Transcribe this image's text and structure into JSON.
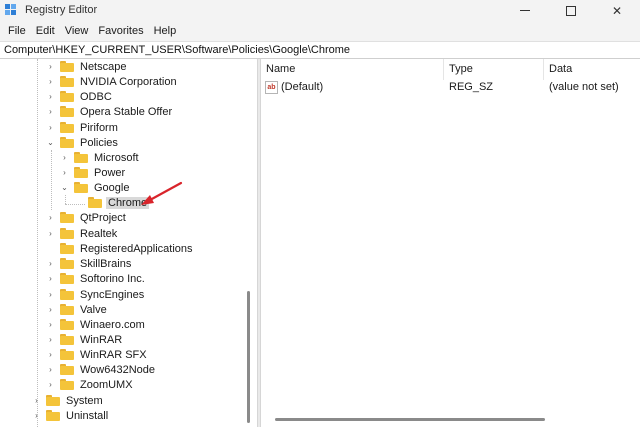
{
  "window": {
    "title": "Registry Editor",
    "controls": {
      "minimize": "",
      "maximize": "",
      "close": "✕"
    }
  },
  "menu": [
    "File",
    "Edit",
    "View",
    "Favorites",
    "Help"
  ],
  "address": "Computer\\HKEY_CURRENT_USER\\Software\\Policies\\Google\\Chrome",
  "tree": {
    "nodes": [
      {
        "label": "Netscape",
        "expander": "›"
      },
      {
        "label": "NVIDIA Corporation",
        "expander": "›"
      },
      {
        "label": "ODBC",
        "expander": "›"
      },
      {
        "label": "Opera Stable Offer",
        "expander": "›"
      },
      {
        "label": "Piriform",
        "expander": "›"
      },
      {
        "label": "Policies",
        "expander": "⌄"
      },
      {
        "label": "Microsoft",
        "expander": "›"
      },
      {
        "label": "Power",
        "expander": "›"
      },
      {
        "label": "Google",
        "expander": "⌄"
      },
      {
        "label": "Chrome",
        "expander": ""
      },
      {
        "label": "QtProject",
        "expander": "›"
      },
      {
        "label": "Realtek",
        "expander": "›"
      },
      {
        "label": "RegisteredApplications",
        "expander": ""
      },
      {
        "label": "SkillBrains",
        "expander": "›"
      },
      {
        "label": "Softorino Inc.",
        "expander": "›"
      },
      {
        "label": "SyncEngines",
        "expander": "›"
      },
      {
        "label": "Valve",
        "expander": "›"
      },
      {
        "label": "Winaero.com",
        "expander": "›"
      },
      {
        "label": "WinRAR",
        "expander": "›"
      },
      {
        "label": "WinRAR SFX",
        "expander": "›"
      },
      {
        "label": "Wow6432Node",
        "expander": "›"
      },
      {
        "label": "ZoomUMX",
        "expander": "›"
      },
      {
        "label": "System",
        "expander": "›"
      },
      {
        "label": "Uninstall",
        "expander": "›"
      }
    ]
  },
  "values": {
    "columns": {
      "name": "Name",
      "type": "Type",
      "data": "Data"
    },
    "rows": [
      {
        "icon": "ab",
        "name": "(Default)",
        "type": "REG_SZ",
        "data": "(value not set)"
      }
    ]
  },
  "colors": {
    "folder": "#f4c43a",
    "selection": "#d9d9d9",
    "annotation_arrow": "#d9242b"
  }
}
